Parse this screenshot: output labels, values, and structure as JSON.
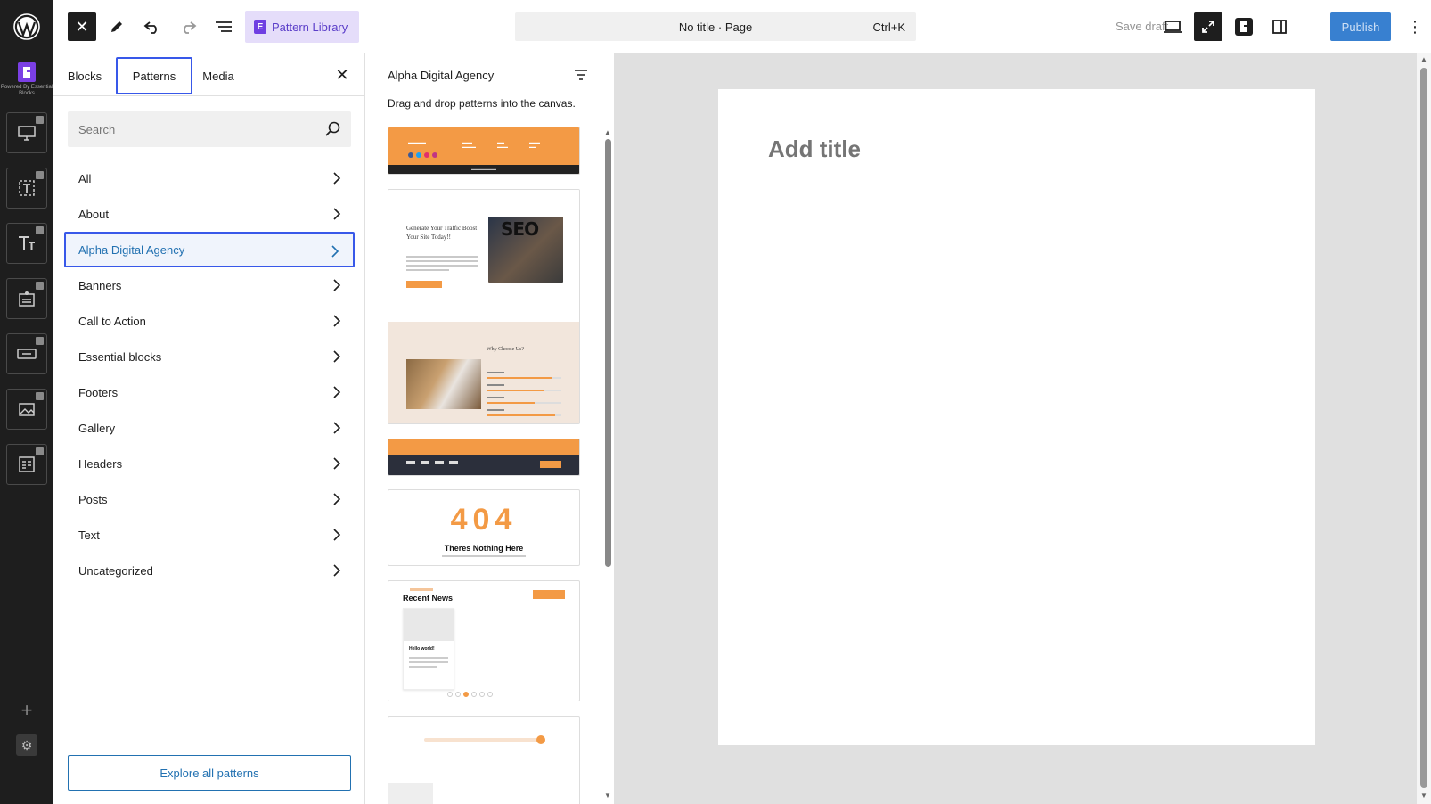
{
  "brand": {
    "eb_caption": "Powered By Essential Blocks"
  },
  "toolbar": {
    "pattern_library_label": "Pattern Library",
    "document_title": "No title · Page",
    "command_shortcut": "Ctrl+K",
    "save_draft_label": "Save draft",
    "publish_label": "Publish",
    "colors": {
      "publish_bg": "#3880d0",
      "pattern_library_bg": "#e5ddfa",
      "accent": "#3858e9"
    }
  },
  "inserter": {
    "tabs": [
      {
        "label": "Blocks"
      },
      {
        "label": "Patterns"
      },
      {
        "label": "Media"
      }
    ],
    "search": {
      "placeholder": "Search",
      "value": ""
    },
    "categories": [
      {
        "label": "All"
      },
      {
        "label": "About"
      },
      {
        "label": "Alpha Digital Agency"
      },
      {
        "label": "Banners"
      },
      {
        "label": "Call to Action"
      },
      {
        "label": "Essential blocks"
      },
      {
        "label": "Footers"
      },
      {
        "label": "Gallery"
      },
      {
        "label": "Headers"
      },
      {
        "label": "Posts"
      },
      {
        "label": "Text"
      },
      {
        "label": "Uncategorized"
      }
    ],
    "active_category": "Alpha Digital Agency",
    "explore_label": "Explore all patterns"
  },
  "patterns_panel": {
    "title": "Alpha Digital Agency",
    "description": "Drag and drop patterns into the canvas.",
    "previews": {
      "hero_headline": "Generate Your Traffic Boost Your Site Today!!",
      "hero_graphic_text": "SEO",
      "why_heading": "Why Choose Us?",
      "error_code": "404",
      "error_heading": "Theres Nothing Here",
      "news_heading": "Recent News",
      "news_card_title": "Hello world!"
    }
  },
  "canvas": {
    "title_placeholder": "Add title"
  }
}
